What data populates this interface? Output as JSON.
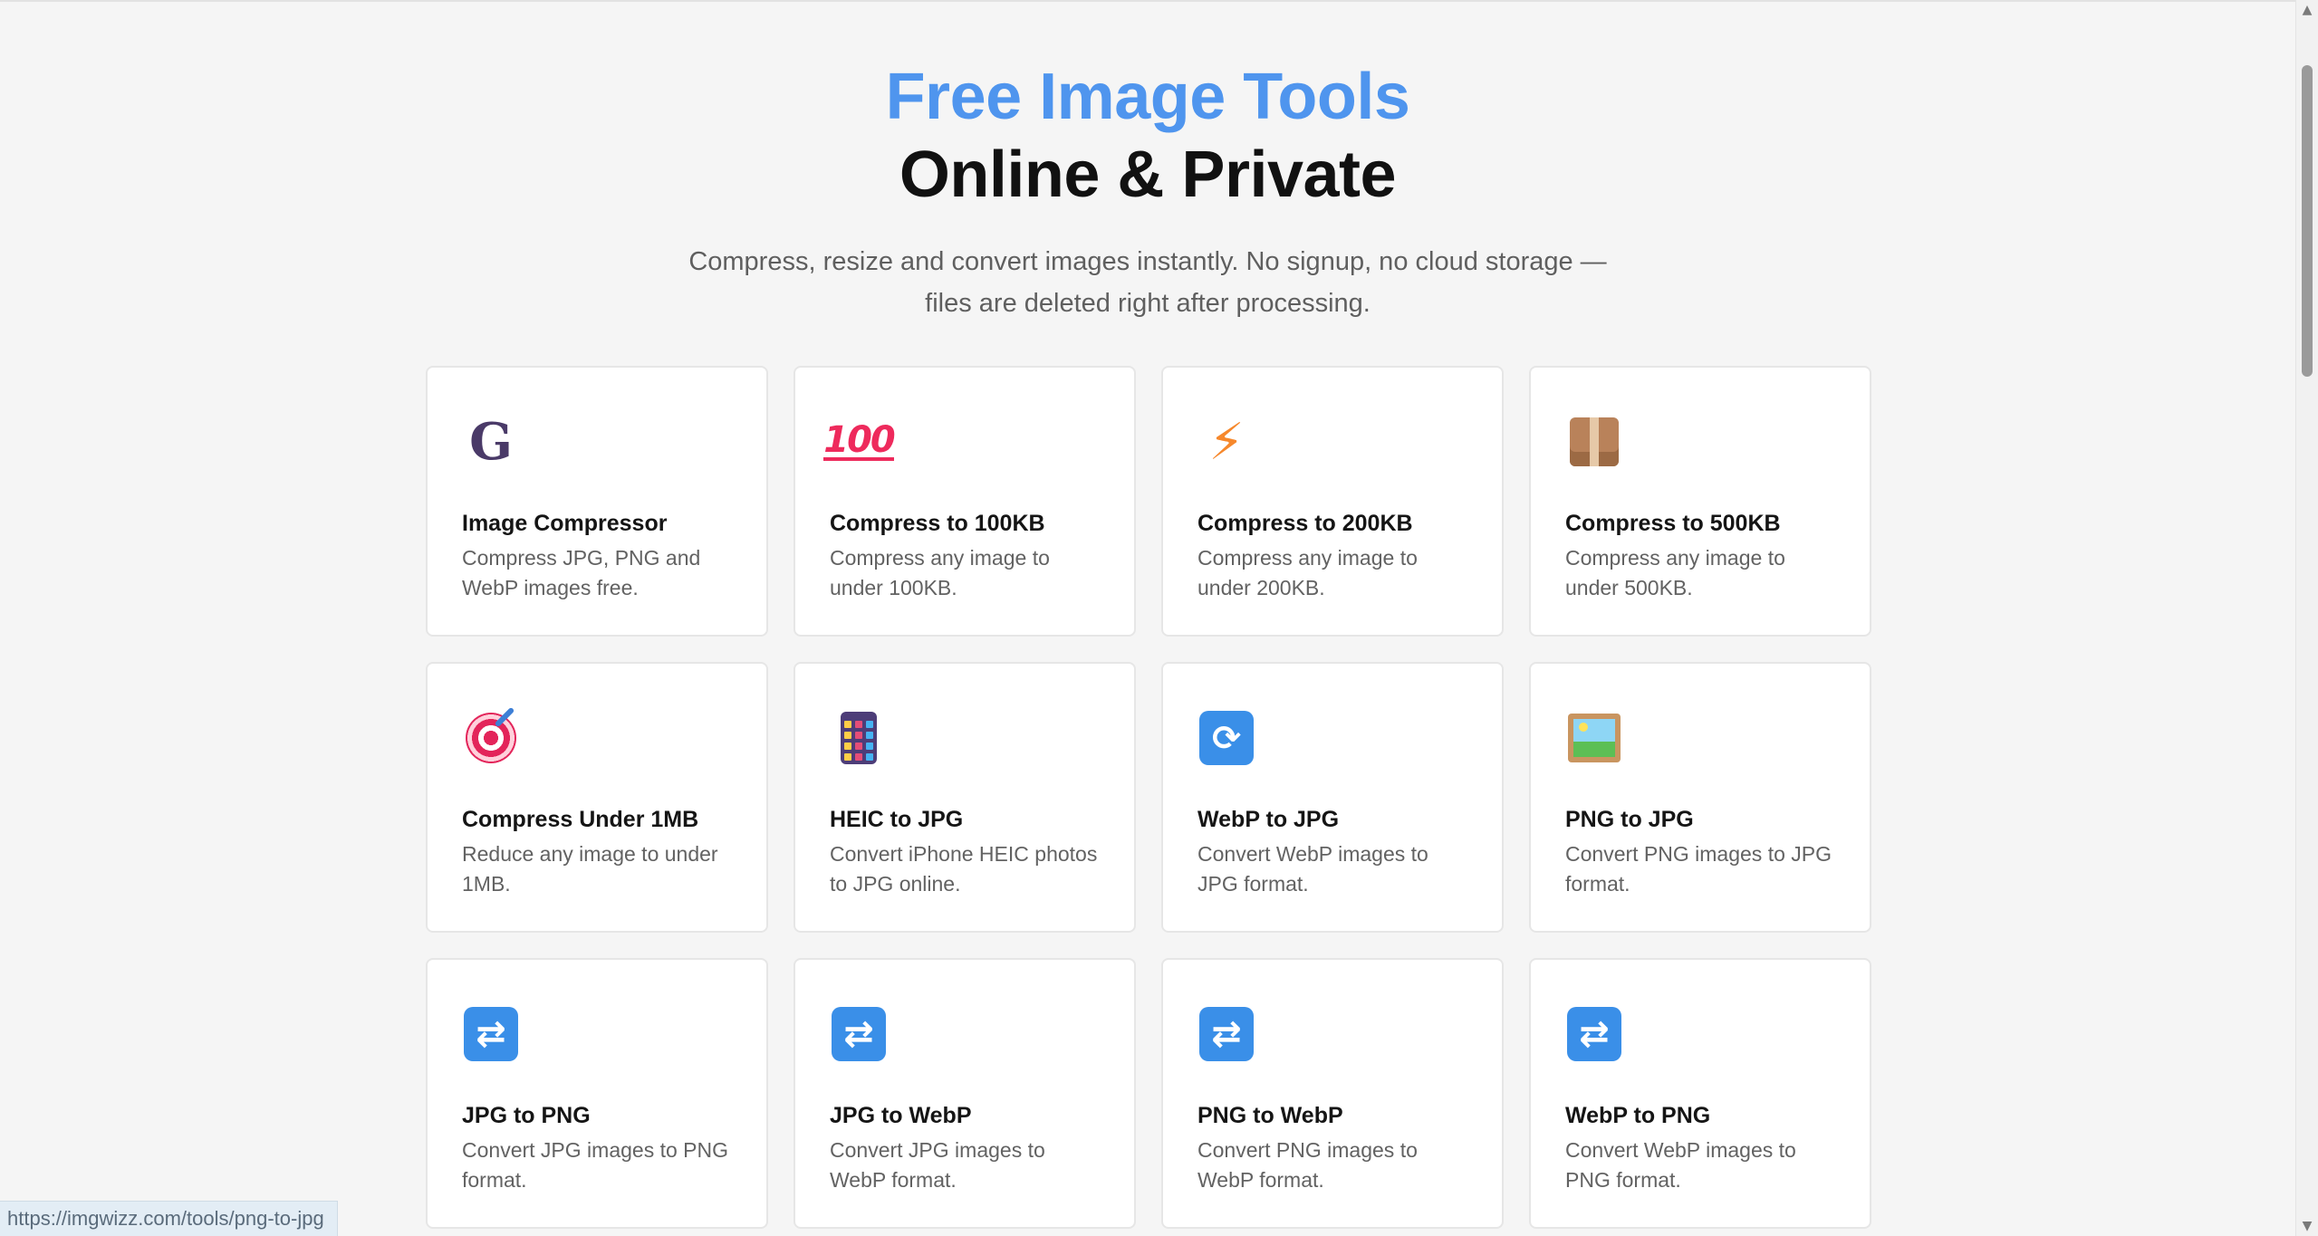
{
  "hero": {
    "title_line1": "Free Image Tools",
    "title_line2": "Online & Private",
    "subtitle_line1": "Compress, resize and convert images instantly. No signup, no cloud storage —",
    "subtitle_line2": "files are deleted right after processing."
  },
  "colors": {
    "accent": "#4f95ee",
    "title": "#111111",
    "text_muted": "#626262",
    "card_border": "#e6e6e6",
    "background": "#f5f5f5"
  },
  "tools": [
    {
      "icon": "clamp-icon",
      "glyph": "G",
      "title": "Image Compressor",
      "desc": "Compress JPG, PNG and WebP images free."
    },
    {
      "icon": "hundred-points-icon",
      "glyph": "100",
      "title": "Compress to 100KB",
      "desc": "Compress any image to under 100KB."
    },
    {
      "icon": "lightning-icon",
      "glyph": "⚡",
      "title": "Compress to 200KB",
      "desc": "Compress any image to under 200KB."
    },
    {
      "icon": "package-icon",
      "glyph": "",
      "title": "Compress to 500KB",
      "desc": "Compress any image to under 500KB."
    },
    {
      "icon": "target-icon",
      "glyph": "",
      "title": "Compress Under 1MB",
      "desc": "Reduce any image to under 1MB."
    },
    {
      "icon": "calculator-icon",
      "glyph": "",
      "title": "HEIC to JPG",
      "desc": "Convert iPhone HEIC photos to JPG online."
    },
    {
      "icon": "refresh-icon",
      "glyph": "⟳",
      "title": "WebP to JPG",
      "desc": "Convert WebP images to JPG format."
    },
    {
      "icon": "framed-picture-icon",
      "glyph": "",
      "title": "PNG to JPG",
      "desc": "Convert PNG images to JPG format."
    },
    {
      "icon": "shuffle-icon",
      "glyph": "⇄",
      "title": "JPG to PNG",
      "desc": "Convert JPG images to PNG format."
    },
    {
      "icon": "shuffle-icon",
      "glyph": "⇄",
      "title": "JPG to WebP",
      "desc": "Convert JPG images to WebP format."
    },
    {
      "icon": "shuffle-icon",
      "glyph": "⇄",
      "title": "PNG to WebP",
      "desc": "Convert PNG images to WebP format."
    },
    {
      "icon": "shuffle-icon",
      "glyph": "⇄",
      "title": "WebP to PNG",
      "desc": "Convert WebP images to PNG format."
    }
  ],
  "status_bar": {
    "url": "https://imgwizz.com/tools/png-to-jpg"
  },
  "scrollbar": {
    "up_glyph": "▲",
    "down_glyph": "▼"
  }
}
